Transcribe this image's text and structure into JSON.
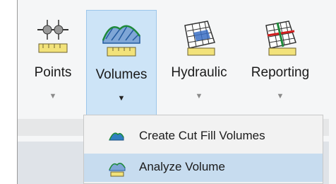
{
  "ribbon": {
    "buttons": [
      {
        "id": "points",
        "label": "Points",
        "icon": "points-icon",
        "active": false
      },
      {
        "id": "volumes",
        "label": "Volumes",
        "icon": "volumes-icon",
        "active": true
      },
      {
        "id": "hydraulic",
        "label": "Hydraulic",
        "icon": "hydraulic-icon",
        "active": false
      },
      {
        "id": "reporting",
        "label": "Reporting",
        "icon": "reporting-icon",
        "active": false
      }
    ],
    "dropdown_arrow": "▼"
  },
  "volumes_menu": {
    "items": [
      {
        "label": "Create Cut Fill Volumes",
        "icon": "cut-fill-icon",
        "highlighted": false
      },
      {
        "label": "Analyze Volume",
        "icon": "analyze-volume-icon",
        "highlighted": true
      }
    ]
  },
  "colors": {
    "active_button_bg": "#cde4f7",
    "menu_highlight_bg": "#c7dcef",
    "ruler_yellow": "#f2e27a"
  }
}
